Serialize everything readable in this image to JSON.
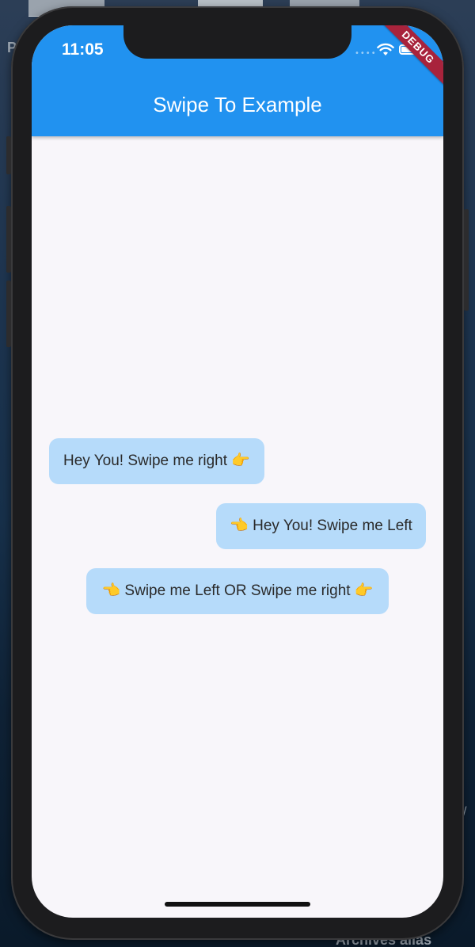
{
  "desktop": {
    "corner_letter": "P",
    "bottom_label": "Archives alias",
    "edge_mark": "/"
  },
  "status_bar": {
    "time": "11:05",
    "icons": [
      "signal-dots-icon",
      "wifi-icon",
      "battery-icon"
    ]
  },
  "debug_banner": {
    "label": "DEBUG"
  },
  "app_bar": {
    "title": "Swipe To Example",
    "color": "#2192f0"
  },
  "messages": [
    {
      "text": "Hey You! Swipe me right 👉",
      "alignment": "left"
    },
    {
      "text": "👈 Hey You! Swipe me Left",
      "alignment": "right"
    },
    {
      "text": "👈 Swipe me Left OR Swipe me right 👉",
      "alignment": "center"
    }
  ],
  "colors": {
    "bubble": "#b6dbfa",
    "screen_background": "#f8f6fa",
    "debug_banner": "#a8233c"
  }
}
